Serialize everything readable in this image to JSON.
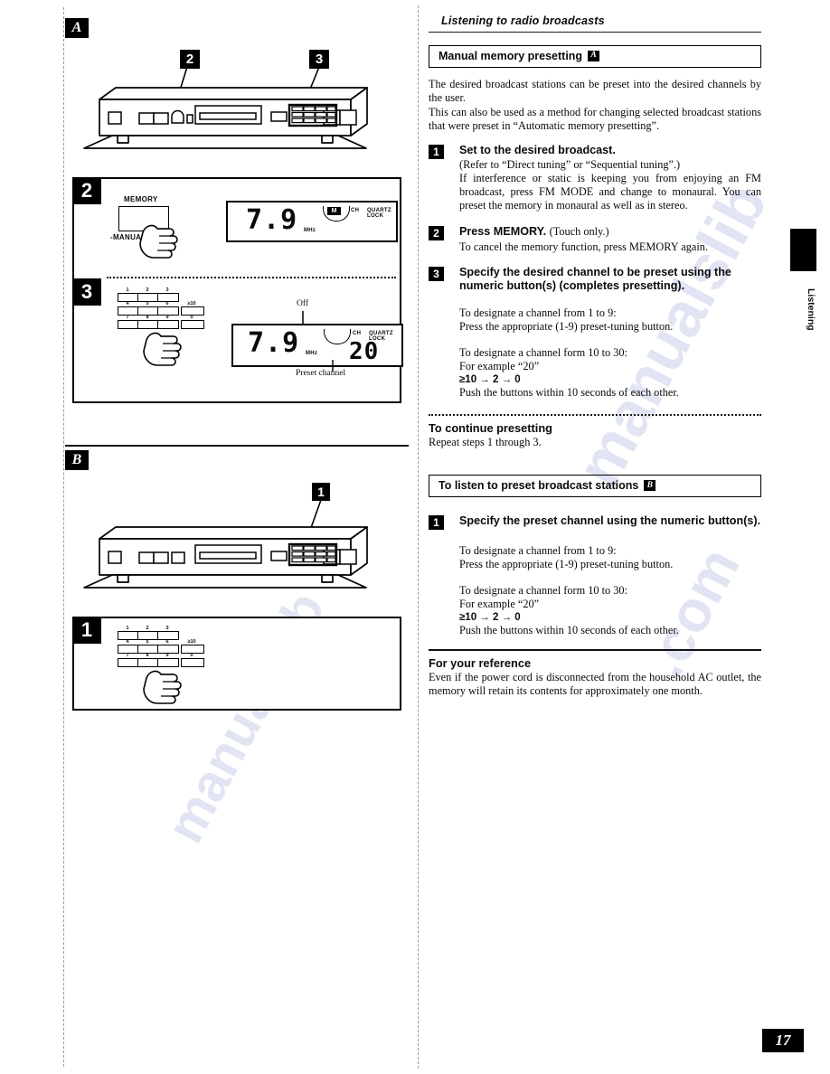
{
  "page": {
    "number": "17",
    "side_tab": "Listening",
    "running_title": "Listening to radio broadcasts"
  },
  "sections": {
    "a": {
      "heading": "Manual memory presetting",
      "badge": "A",
      "intro_1": "The desired broadcast stations can be preset into the desired channels by the user.",
      "intro_2": "This can also be used as a method for changing selected broadcast stations that were preset in “Automatic memory presetting”.",
      "steps": [
        {
          "num": "1",
          "head": "Set to the desired broadcast.",
          "lines": [
            "(Refer to “Direct tuning” or “Sequential tuning”.)",
            "If interference or static is keeping you from enjoying an FM broadcast, press FM MODE and change to monaural. You can preset the memory in monaural as well as in stereo."
          ]
        },
        {
          "num": "2",
          "head": "Press MEMORY.",
          "head_reg": "(Touch only.)",
          "lines": [
            "To cancel the memory function, press MEMORY again."
          ]
        },
        {
          "num": "3",
          "head": "Specify the desired channel to be preset using the numeric button(s) (completes presetting).",
          "lines": [
            "To designate a channel from 1 to 9:",
            "Press the appropriate (1-9) preset-tuning button.",
            "To designate a channel form 10 to 30:",
            "For example “20”",
            "≥10 → 2 → 0",
            "Push the buttons within 10 seconds of each other."
          ]
        }
      ],
      "continue_head": "To continue presetting",
      "continue_body": "Repeat steps 1 through 3."
    },
    "b": {
      "heading": "To listen to preset broadcast stations",
      "badge": "B",
      "steps": [
        {
          "num": "1",
          "head": "Specify the preset channel using the numeric button(s).",
          "lines": [
            "To designate a channel from 1 to 9:",
            "Press the appropriate (1-9) preset-tuning button.",
            "To designate a channel form 10 to 30:",
            "For example “20”",
            "≥10 → 2 → 0",
            "Push the buttons within 10 seconds of each other."
          ]
        }
      ]
    },
    "reference": {
      "heading": "For your reference",
      "body": "Even if the power cord is disconnected from the household AC outlet, the memory will retain its contents for approximately one month."
    }
  },
  "figures": {
    "a": {
      "label": "A",
      "callouts": [
        "2",
        "3"
      ],
      "detail_2": {
        "num": "2",
        "button_top_label": "MEMORY",
        "button_bottom_label": "-MANUAL  AUTO",
        "display": {
          "frequency": "7.9",
          "unit": "MHz",
          "memory_indicator": "M",
          "ch_label": "CH",
          "quartz_lock": "QUARTZ LOCK"
        }
      },
      "detail_3": {
        "num": "3",
        "keypad": [
          "1",
          "2",
          "3",
          "4",
          "5",
          "6",
          "7",
          "8",
          "9"
        ],
        "keypad_extra": [
          "≥10",
          "0"
        ],
        "display": {
          "frequency": "7.9",
          "unit": "MHz",
          "preset": "20",
          "ch_label": "CH",
          "quartz_lock": "QUARTZ LOCK"
        },
        "annotation_off": "Off",
        "annotation_preset": "Preset channel"
      }
    },
    "b": {
      "label": "B",
      "callouts": [
        "1"
      ],
      "detail_1": {
        "num": "1",
        "keypad": [
          "1",
          "2",
          "3",
          "4",
          "5",
          "6",
          "7",
          "8",
          "9"
        ],
        "keypad_extra": [
          "≥10",
          "0"
        ]
      }
    }
  },
  "watermark": {
    "l1": "manualslib",
    "l2": ".com"
  }
}
